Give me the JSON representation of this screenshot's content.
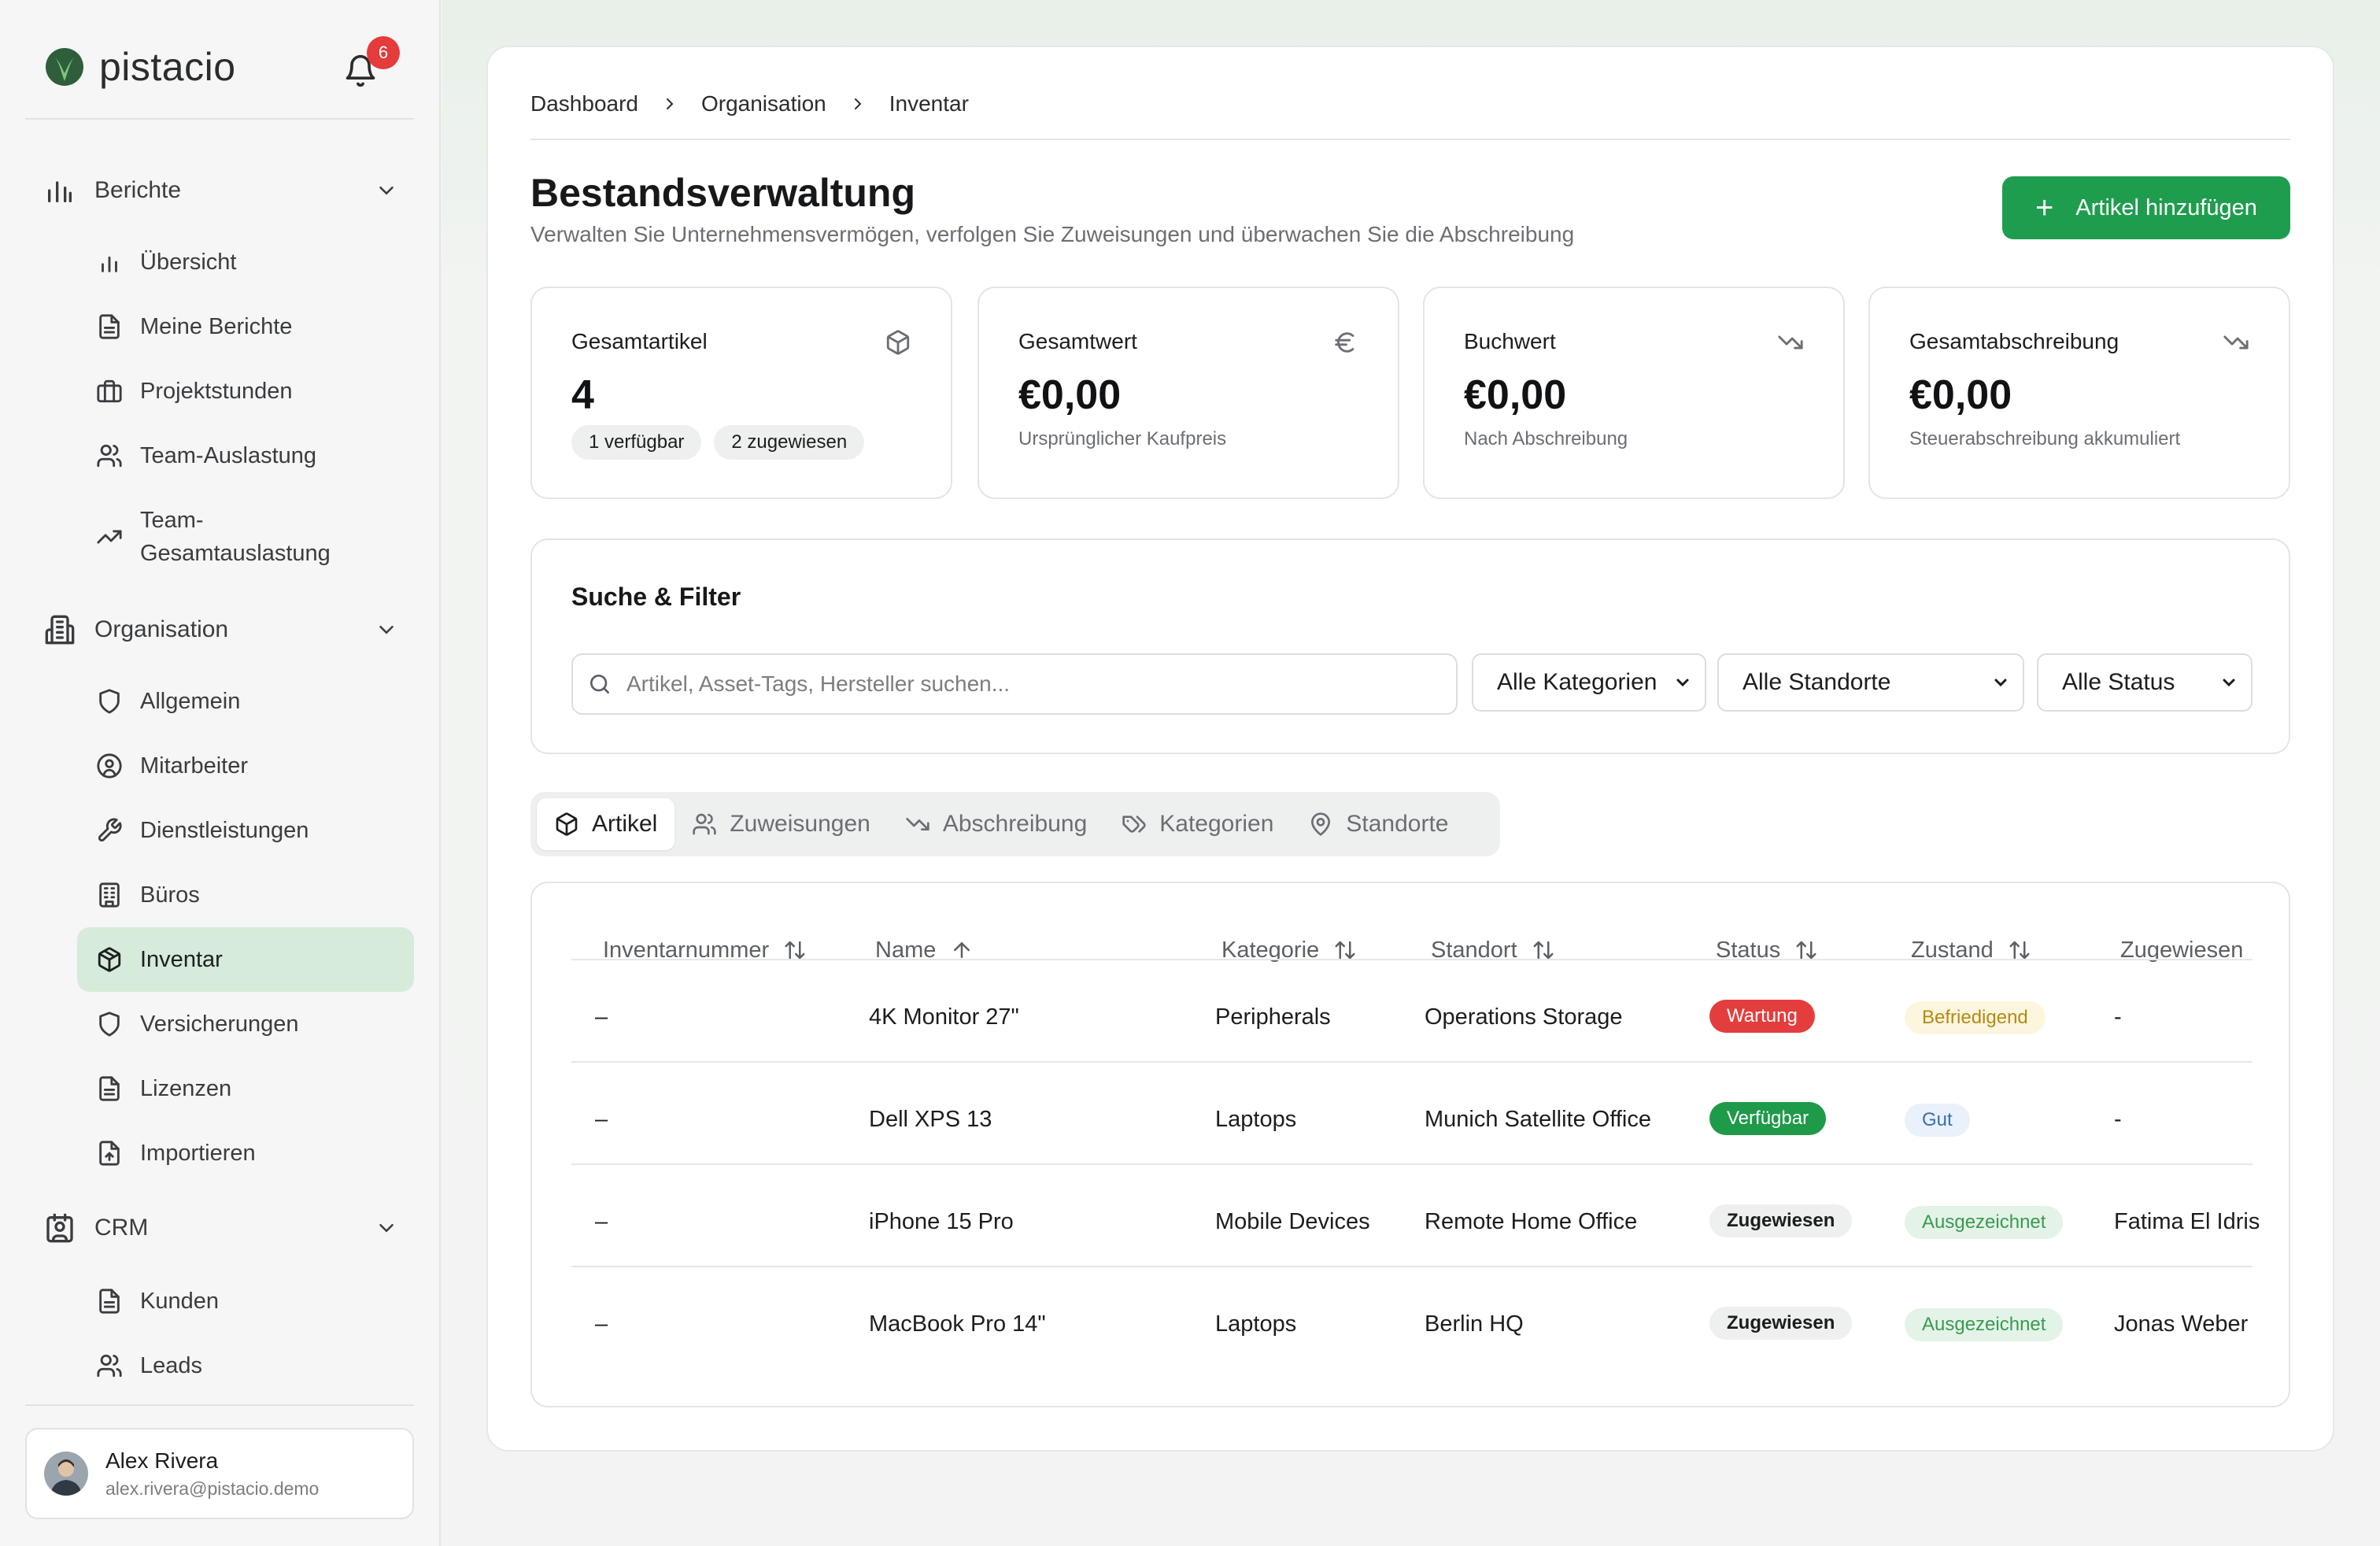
{
  "brand": {
    "name": "pistacio",
    "notifications": "6"
  },
  "sidebar": {
    "sections": [
      {
        "label": "Berichte",
        "items": [
          "Übersicht",
          "Meine Berichte",
          "Projektstunden",
          "Team-Auslastung",
          "Team-Gesamtauslastung"
        ]
      },
      {
        "label": "Organisation",
        "items": [
          "Allgemein",
          "Mitarbeiter",
          "Dienstleistungen",
          "Büros",
          "Inventar",
          "Versicherungen",
          "Lizenzen",
          "Importieren"
        ]
      },
      {
        "label": "CRM",
        "items": [
          "Kunden",
          "Leads"
        ]
      }
    ],
    "team_gesamt_line1": "Team-",
    "team_gesamt_line2": "Gesamtauslastung",
    "active_item": "Inventar"
  },
  "user": {
    "name": "Alex Rivera",
    "email": "alex.rivera@pistacio.demo"
  },
  "breadcrumb": [
    "Dashboard",
    "Organisation",
    "Inventar"
  ],
  "header": {
    "title": "Bestandsverwaltung",
    "subtitle": "Verwalten Sie Unternehmensvermögen, verfolgen Sie Zuweisungen und überwachen Sie die Abschreibung",
    "add_button": "Artikel hinzufügen"
  },
  "stats": [
    {
      "title": "Gesamtartikel",
      "value": "4",
      "icon": "box-icon",
      "pills": [
        "1 verfügbar",
        "2 zugewiesen"
      ]
    },
    {
      "title": "Gesamtwert",
      "value": "€0,00",
      "icon": "euro-icon",
      "sub": "Ursprünglicher Kaufpreis"
    },
    {
      "title": "Buchwert",
      "value": "€0,00",
      "icon": "trend-down-icon",
      "sub": "Nach Abschreibung"
    },
    {
      "title": "Gesamtabschreibung",
      "value": "€0,00",
      "icon": "trend-down-icon",
      "sub": "Steuerabschreibung akkumuliert"
    }
  ],
  "filter": {
    "title": "Suche & Filter",
    "search_placeholder": "Artikel, Asset-Tags, Hersteller suchen...",
    "category": "Alle Kategorien",
    "location": "Alle Standorte",
    "status": "Alle Status"
  },
  "tabs": [
    "Artikel",
    "Zuweisungen",
    "Abschreibung",
    "Kategorien",
    "Standorte"
  ],
  "table": {
    "columns": [
      "Inventarnummer",
      "Name",
      "Kategorie",
      "Standort",
      "Status",
      "Zustand",
      "Zugewiesen"
    ],
    "rows": [
      {
        "inv": "–",
        "name": "4K Monitor 27\"",
        "category": "Peripherals",
        "location": "Operations Storage",
        "status": "Wartung",
        "condition": "Befriedigend",
        "assigned": "-"
      },
      {
        "inv": "–",
        "name": "Dell XPS 13",
        "category": "Laptops",
        "location": "Munich Satellite Office",
        "status": "Verfügbar",
        "condition": "Gut",
        "assigned": "-"
      },
      {
        "inv": "–",
        "name": "iPhone 15 Pro",
        "category": "Mobile Devices",
        "location": "Remote Home Office",
        "status": "Zugewiesen",
        "condition": "Ausgezeichnet",
        "assigned": "Fatima El Idris"
      },
      {
        "inv": "–",
        "name": "MacBook Pro 14\"",
        "category": "Laptops",
        "location": "Berlin HQ",
        "status": "Zugewiesen",
        "condition": "Ausgezeichnet",
        "assigned": "Jonas Weber"
      }
    ]
  }
}
